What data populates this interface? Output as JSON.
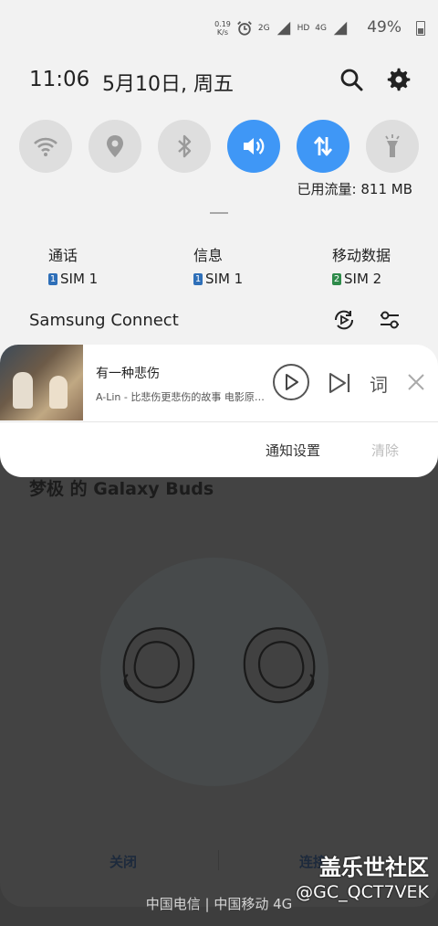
{
  "status_bar": {
    "net_speed_value": "0.19",
    "net_speed_unit": "K/s",
    "sig1_label": "2G",
    "hd_label": "HD",
    "sig2_label": "4G",
    "battery_percent": "49%"
  },
  "header": {
    "time": "11:06",
    "date": "5月10日, 周五"
  },
  "quick_toggles": [
    {
      "name": "wifi",
      "on": false
    },
    {
      "name": "location",
      "on": false
    },
    {
      "name": "bluetooth",
      "on": false
    },
    {
      "name": "sound",
      "on": true
    },
    {
      "name": "mobile-data",
      "on": true
    },
    {
      "name": "flashlight",
      "on": false
    }
  ],
  "data_usage": "已用流量: 811 MB",
  "sim_settings": [
    {
      "title": "通话",
      "sim_num": "1",
      "sim_label": "SIM 1",
      "color": "#2e6fb8"
    },
    {
      "title": "信息",
      "sim_num": "1",
      "sim_label": "SIM 1",
      "color": "#2e6fb8"
    },
    {
      "title": "移动数据",
      "sim_num": "2",
      "sim_label": "SIM 2",
      "color": "#2e8a4a"
    }
  ],
  "samsung_connect": {
    "label": "Samsung Connect"
  },
  "media": {
    "title": "有一种悲伤",
    "subtitle": "A-Lin - 比悲伤更悲伤的故事 电影原声带",
    "lyric_label": "词"
  },
  "notification_actions": {
    "settings": "通知设置",
    "clear": "清除"
  },
  "background_dialog": {
    "title": "梦极 的 Galaxy Buds",
    "close": "关闭",
    "connect": "连接"
  },
  "carrier_text": "中国电信 | 中国移动 4G",
  "watermark": {
    "brand": "盖乐世社区",
    "handle": "@GC_QCT7VEK"
  }
}
